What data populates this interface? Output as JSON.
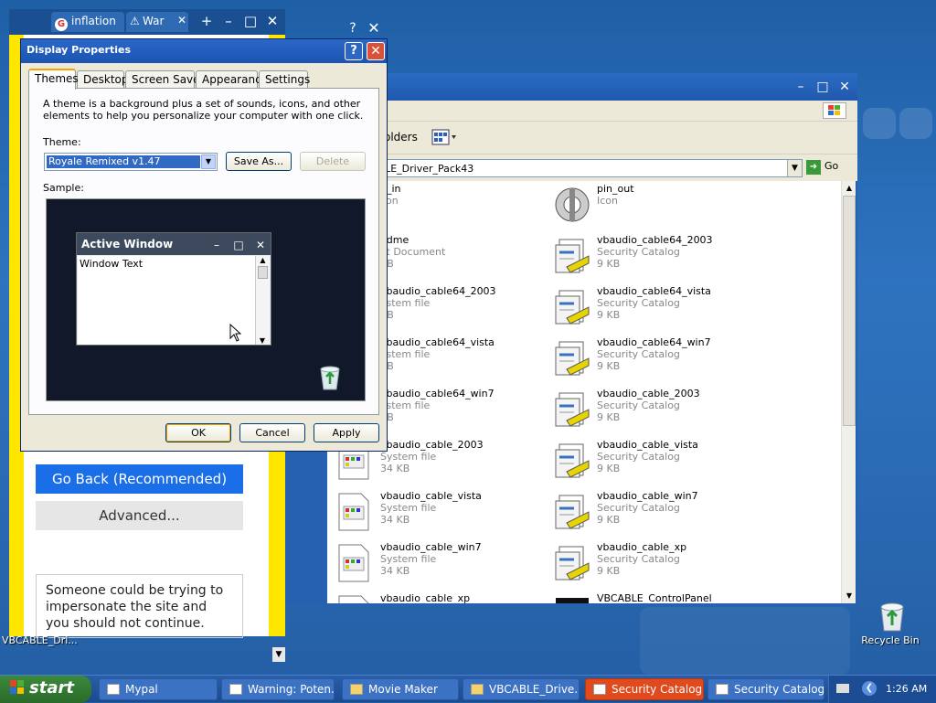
{
  "browser": {
    "tabs": [
      {
        "label": "inflation"
      },
      {
        "label": "War"
      }
    ],
    "go_back_label": "Go Back (Recommended)",
    "advanced_label": "Advanced...",
    "warning_text": "Someone could be trying to impersonate the site and you should not continue."
  },
  "explorer": {
    "folders_label": "olders",
    "address": "ET\\Desktop\\VBCABLE_Driver_Pack43",
    "go_label": "Go",
    "left_column": [
      {
        "name": "n_in",
        "type": "con",
        "size": ""
      },
      {
        "name": "adme",
        "type": "xt Document",
        "size": "KB"
      },
      {
        "name": "vbaudio_cable64_2003",
        "type": "ystem file",
        "size": "KB"
      },
      {
        "name": "vbaudio_cable64_vista",
        "type": "ystem file",
        "size": "KB"
      },
      {
        "name": "vbaudio_cable64_win7",
        "type": "ystem file",
        "size": "KB"
      },
      {
        "name": "vbaudio_cable_2003",
        "type": "System file",
        "size": "34 KB"
      },
      {
        "name": "vbaudio_cable_vista",
        "type": "System file",
        "size": "34 KB"
      },
      {
        "name": "vbaudio_cable_win7",
        "type": "System file",
        "size": "34 KB"
      },
      {
        "name": "vbaudio_cable_xp",
        "type": "",
        "size": ""
      }
    ],
    "right_column": [
      {
        "name": "pin_out",
        "type": "Icon",
        "size": ""
      },
      {
        "name": "vbaudio_cable64_2003",
        "type": "Security Catalog",
        "size": "9 KB"
      },
      {
        "name": "vbaudio_cable64_vista",
        "type": "Security Catalog",
        "size": "9 KB"
      },
      {
        "name": "vbaudio_cable64_win7",
        "type": "Security Catalog",
        "size": "9 KB"
      },
      {
        "name": "vbaudio_cable_2003",
        "type": "Security Catalog",
        "size": "9 KB"
      },
      {
        "name": "vbaudio_cable_vista",
        "type": "Security Catalog",
        "size": "9 KB"
      },
      {
        "name": "vbaudio_cable_win7",
        "type": "Security Catalog",
        "size": "9 KB"
      },
      {
        "name": "vbaudio_cable_xp",
        "type": "Security Catalog",
        "size": "9 KB"
      },
      {
        "name": "VBCABLE_ControlPanel",
        "type": "",
        "size": ""
      }
    ]
  },
  "dialog": {
    "title": "Display Properties",
    "tabs": [
      "Themes",
      "Desktop",
      "Screen Saver",
      "Appearance",
      "Settings"
    ],
    "description": "A theme is a background plus a set of sounds, icons, and other elements to help you personalize your computer with one click.",
    "theme_label": "Theme:",
    "theme_value": "Royale Remixed v1.47",
    "save_as_label": "Save As...",
    "delete_label": "Delete",
    "sample_label": "Sample:",
    "preview_title": "Active Window",
    "preview_text": "Window Text",
    "ok_label": "OK",
    "cancel_label": "Cancel",
    "apply_label": "Apply"
  },
  "desktop": {
    "recycle_bin_label": "Recycle Bin",
    "vbcable_label": "VBCABLE_Dri..."
  },
  "taskbar": {
    "start_label": "start",
    "items": [
      {
        "label": "Mypal",
        "active": false
      },
      {
        "label": "Warning: Poten...",
        "active": false
      },
      {
        "label": "Movie Maker",
        "active": false
      },
      {
        "label": "VBCABLE_Drive...",
        "active": false
      },
      {
        "label": "Security Catalog",
        "active": true
      },
      {
        "label": "Security Catalog",
        "active": false
      }
    ],
    "clock": "1:26 AM"
  },
  "colors": {
    "desktop": "#2a6ab3",
    "warning_yellow": "#ffe600",
    "go_back_blue": "#1a6fe8",
    "taskbar_active": "#e04a1c"
  }
}
